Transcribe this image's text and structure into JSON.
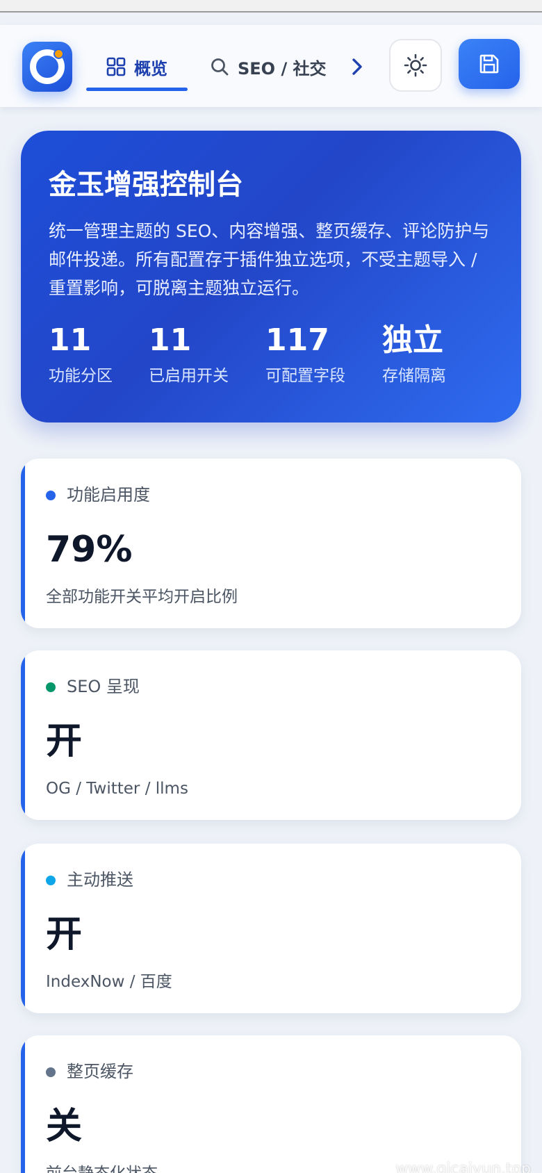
{
  "header": {
    "tabs": [
      {
        "label": "概览",
        "icon": "grid-icon",
        "active": true
      },
      {
        "label": "SEO / 社交",
        "icon": "search-icon",
        "active": false
      }
    ],
    "next_icon": "chevron-right-icon",
    "theme_icon": "sun-icon",
    "save_icon": "save-icon"
  },
  "hero": {
    "title": "金玉增强控制台",
    "description": "统一管理主题的 SEO、内容增强、整页缓存、评论防护与邮件投递。所有配置存于插件独立选项，不受主题导入 / 重置影响，可脱离主题独立运行。",
    "stats": [
      {
        "value": "11",
        "label": "功能分区"
      },
      {
        "value": "11",
        "label": "已启用开关"
      },
      {
        "value": "117",
        "label": "可配置字段"
      },
      {
        "value": "独立",
        "label": "存储隔离"
      }
    ]
  },
  "cards": [
    {
      "label": "功能启用度",
      "value": "79%",
      "sub": "全部功能开关平均开启比例",
      "dot_color": "#2563eb"
    },
    {
      "label": "SEO 呈现",
      "value": "开",
      "sub": "OG / Twitter / llms",
      "dot_color": "#059669"
    },
    {
      "label": "主动推送",
      "value": "开",
      "sub": "IndexNow / 百度",
      "dot_color": "#0ea5e9"
    },
    {
      "label": "整页缓存",
      "value": "关",
      "sub": "前台静态化状态",
      "dot_color": "#64748b"
    }
  ],
  "colors": {
    "accent": "#2563eb",
    "hero_start": "#1d4ed8",
    "hero_end": "#2f6cf0"
  },
  "watermark": "www.qicaiyun.top"
}
